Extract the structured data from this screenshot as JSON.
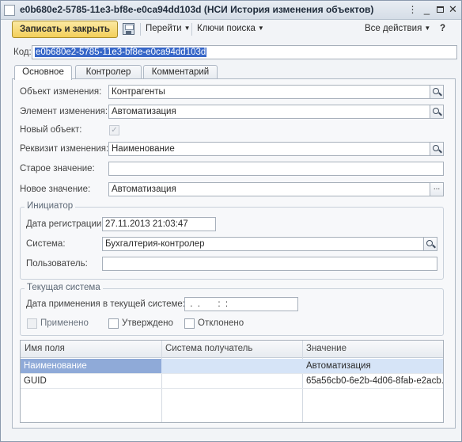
{
  "window": {
    "title": "e0b680e2-5785-11e3-bf8e-e0ca94dd103d (НСИ История изменения объектов)",
    "more_glyph": "⋮",
    "min_glyph": "_",
    "close_glyph": "✕"
  },
  "toolbar": {
    "save_close_label": "Записать и закрыть",
    "goto_label": "Перейти",
    "search_keys_label": "Ключи поиска",
    "all_actions_label": "Все действия"
  },
  "code": {
    "label": "Код:",
    "value": "e0b680e2-5785-11e3-bf8e-e0ca94dd103d"
  },
  "tabs": [
    {
      "label": "Основное",
      "active": true
    },
    {
      "label": "Контролер",
      "active": false
    },
    {
      "label": "Комментарий",
      "active": false
    }
  ],
  "main": {
    "object_label": "Объект изменения:",
    "object_value": "Контрагенты",
    "element_label": "Элемент изменения:",
    "element_value": "Автоматизация",
    "new_object_label": "Новый объект:",
    "new_object_checked": true,
    "attr_label": "Реквизит изменения:",
    "attr_value": "Наименование",
    "old_value_label": "Старое значение:",
    "old_value": "",
    "new_value_label": "Новое значение:",
    "new_value": "Автоматизация"
  },
  "initiator": {
    "title": "Инициатор",
    "reg_date_label": "Дата регистрации:",
    "reg_date_value": "27.11.2013 21:03:47",
    "system_label": "Система:",
    "system_value": "Бухгалтерия-контролер",
    "user_label": "Пользователь:",
    "user_value": ""
  },
  "current_system": {
    "title": "Текущая система",
    "apply_date_label": "Дата применения в текущей системе:",
    "apply_date_value": " .  .       :  :",
    "applied_label": "Применено",
    "applied_checked": false,
    "approved_label": "Утверждено",
    "approved_checked": false,
    "rejected_label": "Отклонено",
    "rejected_checked": false
  },
  "table": {
    "columns": [
      "Имя поля",
      "Система получатель",
      "Значение"
    ],
    "rows": [
      [
        "Наименование",
        "",
        "Автоматизация"
      ],
      [
        "GUID",
        "",
        "65a56cb0-6e2b-4d06-8fab-e2acb..."
      ]
    ]
  },
  "colors": {
    "primary_button": "#f3cf5a",
    "selection": "#3767c8",
    "selected_row": "#d6e4f7"
  }
}
